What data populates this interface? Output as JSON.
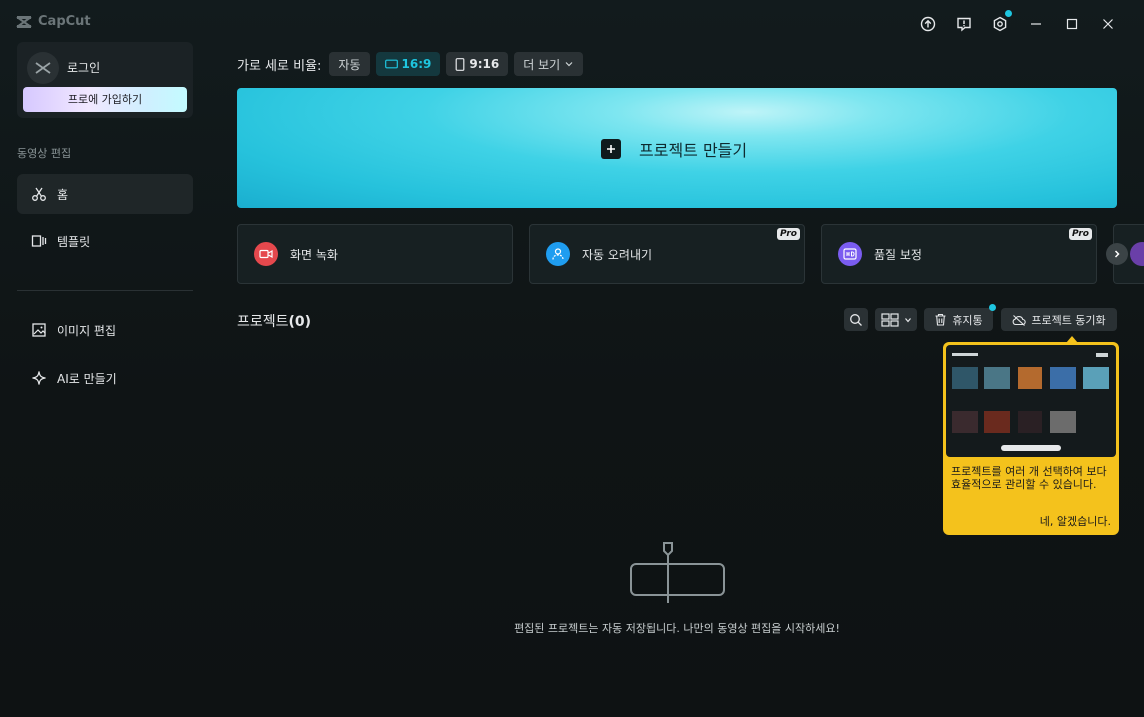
{
  "app": {
    "name": "CapCut"
  },
  "colors": {
    "accent": "#1ec6e0",
    "tooltip": "#f4c21c",
    "record": "#e5484d",
    "cutout": "#1f9df0",
    "enhance": "#7a5cf0"
  },
  "sidebar": {
    "login_label": "로그인",
    "pro_button": "프로에 가입하기",
    "section_label": "동영상 편집",
    "items": [
      {
        "id": "home",
        "label": "홈",
        "icon": "scissors-icon"
      },
      {
        "id": "templates",
        "label": "템플릿",
        "icon": "template-icon"
      },
      {
        "id": "image-edit",
        "label": "이미지 편집",
        "icon": "image-icon"
      },
      {
        "id": "ai-create",
        "label": "AI로 만들기",
        "icon": "sparkle-icon"
      }
    ]
  },
  "ratio": {
    "label": "가로 세로 비율:",
    "options": [
      "자동",
      "16:9",
      "9:16"
    ],
    "more": "더 보기"
  },
  "hero": {
    "label": "프로젝트 만들기"
  },
  "tools": [
    {
      "label": "화면 녹화",
      "pro": false
    },
    {
      "label": "자동 오려내기",
      "pro": true
    },
    {
      "label": "품질 보정",
      "pro": true
    }
  ],
  "pro_badge": "Pro",
  "projects": {
    "title": "프로젝트",
    "count": "(0)",
    "trash": "휴지통",
    "sync": "프로젝트 동기화",
    "empty": "편집된 프로젝트는 자동 저장됩니다. 나만의 동영상 편집을 시작하세요!"
  },
  "tooltip": {
    "text": "프로젝트를 여러 개 선택하여 보다 효율적으로 관리할 수 있습니다.",
    "ok": "네, 알겠습니다."
  }
}
